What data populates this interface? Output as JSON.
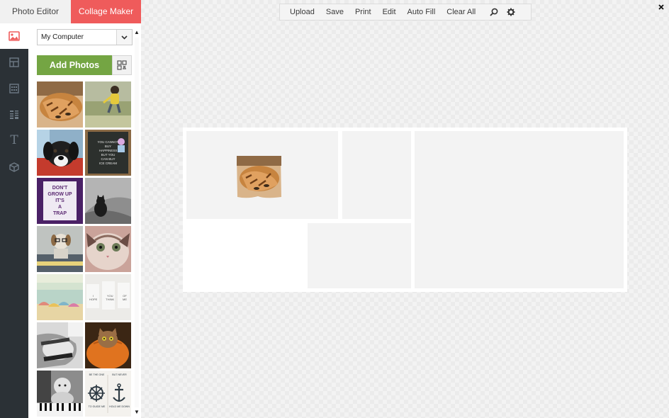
{
  "mode_tabs": {
    "photo_editor": "Photo Editor",
    "collage_maker": "Collage Maker"
  },
  "rail": {
    "items": [
      "photos-icon",
      "layouts-icon",
      "grid-icon",
      "patterns-icon",
      "text-icon",
      "stickers-icon"
    ],
    "text_glyph": "T",
    "active": "photos-icon"
  },
  "panel": {
    "source": {
      "value": "My Computer",
      "options": [
        "My Computer"
      ]
    },
    "add_photos_label": "Add Photos",
    "thumbnails": [
      {
        "subject": "sleeping tabby kitten"
      },
      {
        "subject": "child walking in field"
      },
      {
        "subject": "puppy on red blanket"
      },
      {
        "subject": "chalkboard note",
        "text": [
          "YOU CANNOT",
          "BUY",
          "HAPPINESS",
          "BUT YOU",
          "CAN BUY",
          "ICE CREAM"
        ]
      },
      {
        "subject": "letter board sign",
        "text": [
          "DON'T",
          "GROW UP",
          "IT'S",
          "A",
          "TRAP"
        ]
      },
      {
        "subject": "black and white cat"
      },
      {
        "subject": "dog with glasses"
      },
      {
        "subject": "cat face closeup"
      },
      {
        "subject": "beach umbrellas"
      },
      {
        "subject": "hope you think of me",
        "text": [
          "I",
          "HOPE",
          "YOU",
          "THINK",
          "OF",
          "ME"
        ]
      },
      {
        "subject": "pregnant belly"
      },
      {
        "subject": "cat in pumpkin"
      },
      {
        "subject": "baby at piano"
      },
      {
        "subject": "anchor and wheel quote",
        "text": [
          "BE THE ONE",
          "TO GUIDE ME",
          "BUT NEVER",
          "HOLD ME DOWN"
        ]
      }
    ]
  },
  "toolbar": {
    "upload": "Upload",
    "save": "Save",
    "print": "Print",
    "edit": "Edit",
    "auto_fill": "Auto Fill",
    "clear_all": "Clear All",
    "icons": [
      "search-icon",
      "gear-icon"
    ]
  },
  "colors": {
    "accent": "#ef5b5b",
    "add_button": "#74a543",
    "rail_bg": "#2b3136",
    "cell_bg": "#f3f3f3"
  }
}
